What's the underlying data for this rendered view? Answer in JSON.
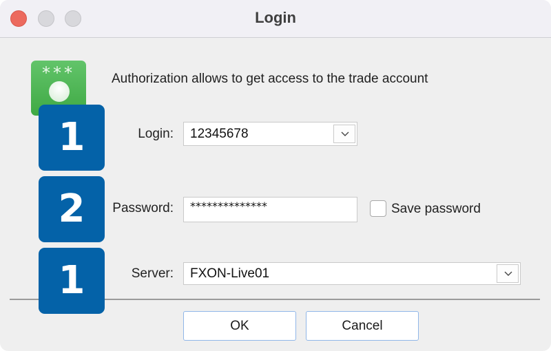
{
  "window": {
    "title": "Login",
    "controls": [
      "close",
      "minimize",
      "maximize"
    ]
  },
  "header": {
    "icon": "password-key-icon",
    "icon_stars": "***",
    "info_text": "Authorization allows to get access to the trade account"
  },
  "badges": [
    {
      "number": "1",
      "color": "#0462a8"
    },
    {
      "number": "2",
      "color": "#0462a8"
    },
    {
      "number": "1",
      "color": "#0462a8"
    }
  ],
  "form": {
    "login": {
      "label": "Login:",
      "value": "12345678"
    },
    "password": {
      "label": "Password:",
      "value": "**************"
    },
    "save_password": {
      "label": "Save password",
      "checked": false
    },
    "server": {
      "label": "Server:",
      "value": "FXON-Live01"
    }
  },
  "buttons": {
    "ok": "OK",
    "cancel": "Cancel"
  },
  "colors": {
    "accent_blue": "#0462a8",
    "icon_green": "#4fb756",
    "close_red": "#ec6a5e",
    "button_border": "#8fb6e8"
  }
}
